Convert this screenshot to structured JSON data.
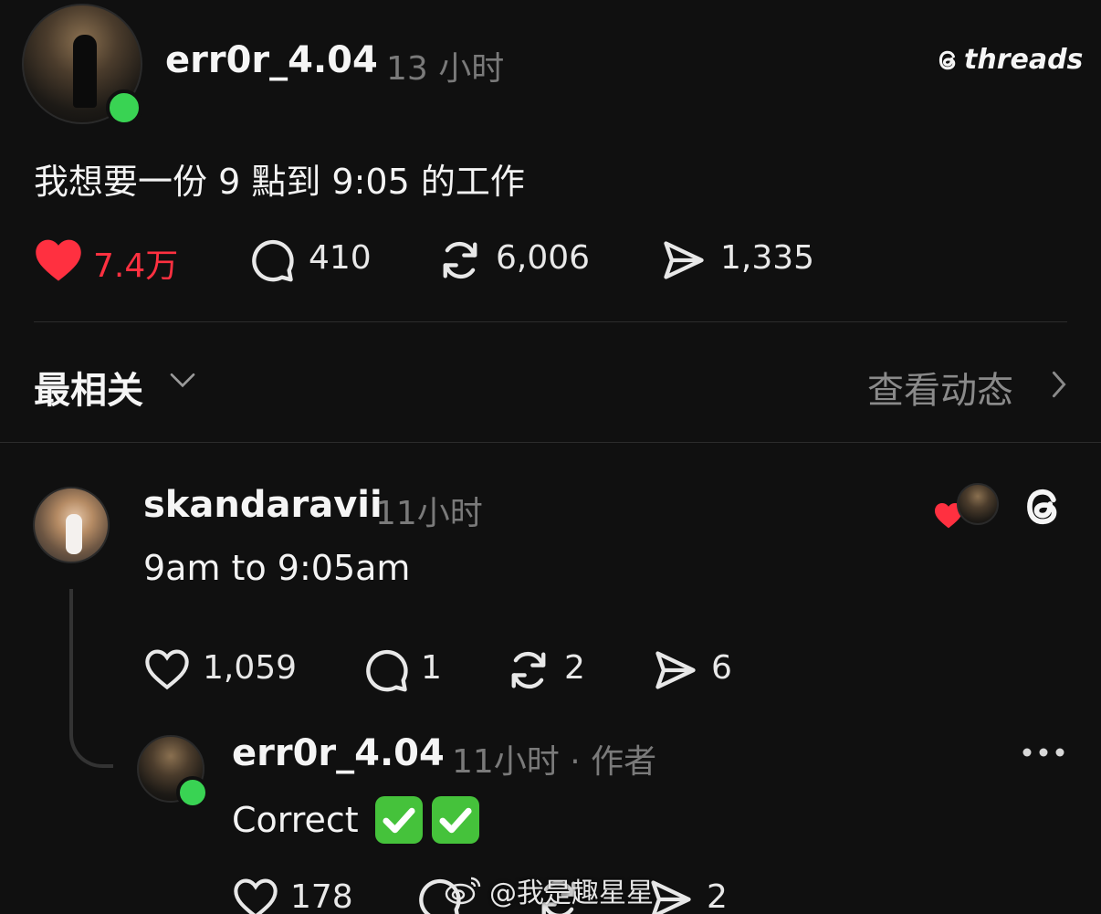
{
  "post": {
    "username": "err0r_4.04",
    "time": "13 小时",
    "text": "我想要一份 9 點到 9:05 的工作",
    "likes": "7.4万",
    "replies": "410",
    "reposts": "6,006",
    "shares": "1,335"
  },
  "brand": {
    "name": "threads"
  },
  "sort": {
    "label": "最相关",
    "activity": "查看动态"
  },
  "comment": {
    "username": "skandaravii",
    "time": "11小时",
    "text": "9am to 9:05am",
    "likes": "1,059",
    "replies": "1",
    "reposts": "2",
    "shares": "6"
  },
  "reply": {
    "username": "err0r_4.04",
    "time": "11小时 · 作者",
    "text": "Correct",
    "likes": "178",
    "shares": "2"
  },
  "watermark": "@我是趣星星",
  "colors": {
    "accent_red": "#ff3040",
    "online_green": "#39d353",
    "background": "#101010",
    "check_green": "#45c23b"
  }
}
